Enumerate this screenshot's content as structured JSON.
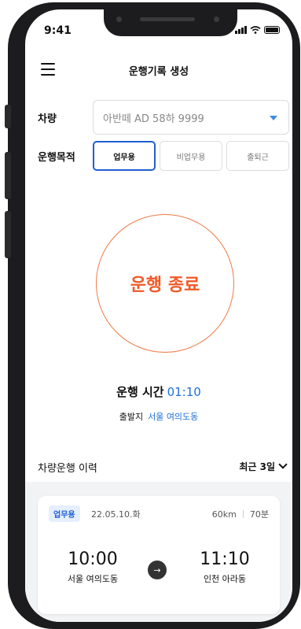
{
  "status": {
    "time": "9:41"
  },
  "header": {
    "title": "운행기록 생성"
  },
  "form": {
    "vehicle_label": "차량",
    "vehicle_value": "아반떼 AD 58하 9999",
    "purpose_label": "운행목적",
    "purposes": [
      {
        "label": "업무용",
        "selected": true
      },
      {
        "label": "비업무용",
        "selected": false
      },
      {
        "label": "출퇴근",
        "selected": false
      }
    ]
  },
  "action": {
    "end_label": "운행 종료"
  },
  "drive": {
    "time_label": "운행 시간",
    "time_value": "01:10",
    "origin_label": "출발지",
    "origin_value": "서울 여의도동"
  },
  "history": {
    "title": "차량운행 이력",
    "period": "최근 3일",
    "records": [
      {
        "badge": "업무용",
        "date": "22.05.10.화",
        "distance": "60km",
        "duration": "70분",
        "start_time": "10:00",
        "start_place": "서울 여의도동",
        "end_time": "11:10",
        "end_place": "인천 아라동"
      }
    ]
  },
  "colors": {
    "accent": "#1f5fd1",
    "end_button": "#f05a28"
  },
  "icons": [
    "menu-icon",
    "caret-down-icon",
    "chevron-down-icon",
    "arrow-right-icon",
    "signal-icon",
    "wifi-icon",
    "battery-icon"
  ]
}
